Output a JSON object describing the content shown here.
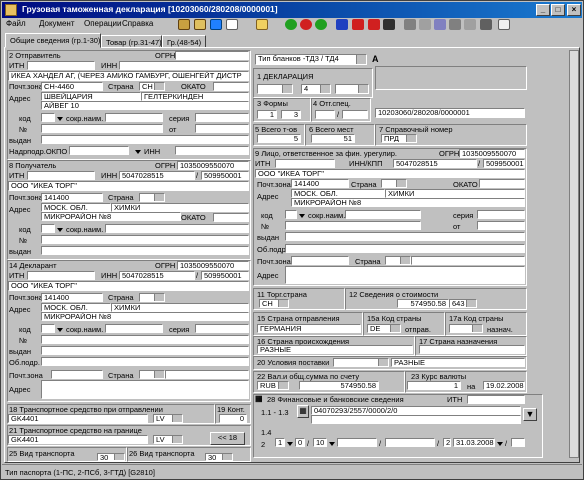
{
  "window": {
    "title": "Грузовая таможенная декларация [10203060/280208/0000001]",
    "min_label": "_",
    "max_label": "□",
    "close_label": "×"
  },
  "menu": [
    "Файл",
    "Документ",
    "Операции",
    "Справка"
  ],
  "tabs": [
    "Общие сведения (гр.1-30)",
    "Товар (гр.31-47)",
    "Гр.(48-54)"
  ],
  "section2": {
    "title": "2 Отправитель",
    "ogrn_label": "ОГРН",
    "inn_label": "ИТН",
    "inn2_label": "ИНН",
    "name": "ИКЕА ХАНДЕЛ АГ, (ЧЕРЕЗ АМИКО ГАМБУРГ, ОШЕНГЕЙТ ДИСТР",
    "postcode_label": "Почт.зона",
    "postcode": "CH-4460",
    "country_label": "Страна",
    "country": "CH",
    "okato_label": "ОКАТО",
    "address_label": "Адрес",
    "address1": "ШВЕЙЦАРИЯ",
    "address2": "ГЕЛТЕРКИНДЕН",
    "address3": "АЙВЕГ 10",
    "code_label": "код",
    "short_label": "сокр.наим.",
    "series_label": "серия",
    "no_label": "№",
    "from_label": "от",
    "issued_label": "выдан",
    "subdiv_label": "Надрподр.ОКПО",
    "inn3_label": "ИНН"
  },
  "section8": {
    "title": "8 Получатель",
    "ogrn_label": "ОГРН",
    "ogrn": "1035009550070",
    "inn_label": "ИТН",
    "inn2_label": "ИНН",
    "inn2": "5047028515",
    "kpp": "509950001",
    "name": "ООО \"ИКЕА ТОРГ\"",
    "postcode_label": "Почт.зона",
    "postcode": "141400",
    "country_label": "Страна",
    "address_label": "Адрес",
    "address1": "МОСК. ОБЛ.",
    "address2": "ХИМКИ",
    "address3": "МИКРОРАЙОН №8",
    "okato_label": "ОКАТО",
    "code_label": "код",
    "short_label": "сокр.наим.",
    "no_label": "№",
    "issued_label": "выдан"
  },
  "section14": {
    "title": "14 Декларант",
    "ogrn_label": "ОГРН",
    "ogrn": "1035009550070",
    "inn_label": "ИТН",
    "inn2_label": "ИНН",
    "inn2": "5047028515",
    "kpp": "509950001",
    "name": "ООО \"ИКЕА ТОРГ\"",
    "postcode_label": "Почт.зона",
    "postcode": "141400",
    "country_label": "Страна",
    "address_label": "Адрес",
    "address1": "МОСК. ОБЛ.",
    "address2": "ХИМКИ",
    "address3": "МИКРОРАЙОН №8",
    "code_label": "код",
    "short_label": "сокр.наим.",
    "series_label": "серия",
    "no_label": "№",
    "issued_label": "выдан",
    "subdiv_label": "Об.подр.",
    "postcode2_label": "Почт.зона",
    "country2_label": "Страна",
    "address2_label": "Адрес"
  },
  "section18": {
    "title": "18 Транспортное средство при отправлении",
    "value": "GK4401",
    "country": "LV",
    "cont_title": "19 Конт.",
    "cont": "0"
  },
  "section21": {
    "title": "21 Транспортное средство на границе",
    "value": "GK4401",
    "country": "LV",
    "button": "<< 18"
  },
  "section25": {
    "title": "25 Вид транспорта",
    "value": "30"
  },
  "section26": {
    "title": "26 Вид транспорта",
    "value": "30"
  },
  "right": {
    "blank_type": "Тип бланков -ТД3 / ТД4",
    "letter_a": "A",
    "decl_title": "1 ДЕКЛАРАЦИЯ",
    "decl2": "4",
    "forms_title": "3 Формы",
    "forms1": "1",
    "forms2": "3",
    "spec_title": "4 Отг.спец.",
    "decl_number": "10203060/280208/0000001",
    "total_title": "5 Всего т-ов",
    "total": "5",
    "places_title": "6 Всего мест",
    "places": "51",
    "ref_title": "7 Справочный номер",
    "ref": "ПРД",
    "responsible_title": "9 Лицо, ответственное за фин. урегулир.",
    "resp_ogrn_label": "ОГРН",
    "resp_ogrn": "1035009550070",
    "resp_inn_label": "ИТН",
    "resp_kpp_label": "ИНН/КПП",
    "resp_inn": "5047028515",
    "resp_kpp": "509950001",
    "resp_name": "ООО \"ИКЕА ТОРГ\"",
    "resp_postcode_label": "Почт.зона",
    "resp_postcode": "141400",
    "resp_country_label": "Страна",
    "resp_okato_label": "ОКАТО",
    "resp_address_label": "Адрес",
    "resp_address1": "МОСК. ОБЛ.",
    "resp_address2": "ХИМКИ",
    "resp_address3": "МИКРОРАЙОН №8",
    "resp_code_label": "код",
    "resp_short_label": "сокр.наим.",
    "resp_series_label": "серия",
    "resp_no_label": "№",
    "resp_from_label": "от",
    "resp_issued_label": "выдан",
    "resp_subdiv_label": "Об.подр.",
    "resp_postcode2_label": "Почт.зона",
    "resp_country2_label": "Страна",
    "resp_address2_label": "Адрес",
    "trade_country_title": "11 Торг.страна",
    "trade_country": "CH",
    "cost_title": "12 Сведения о стоимости",
    "cost": "574950.58",
    "cost_code": "643",
    "dispatch_title": "15 Страна отправления",
    "dispatch": "ГЕРМАНИЯ",
    "dispatch_code_title": "15a Код страны",
    "dispatch_code": "DE",
    "dispatch_code_sub": "отправ.",
    "dest_code_title": "17a Код страны",
    "dest_code_sub": "назнач.",
    "origin_title": "16 Страна происхождения",
    "origin": "РАЗНЫЕ",
    "dest_title": "17 Страна назначения",
    "delivery_title": "20 Условия поставки",
    "delivery": "РАЗНЫЕ",
    "currency_title": "22 Вал.и общ.сумма по счету",
    "currency": "RUB",
    "amount": "574950.58",
    "rate_title": "23 Курс валюты",
    "rate": "1",
    "rate_na": "на",
    "rate_date": "19.02.2008",
    "bank_title": "28 Финансовые и банковские сведения",
    "bank_inn_label": "ИТН",
    "bank_row1_label": "1.1 - 1.3",
    "bank_doc": "04070293/2557/0000/2/0",
    "bank_row2_label": "1.4",
    "bank_row3_label": "2",
    "bank_v1": "1",
    "bank_v2": "0",
    "bank_v3": "10",
    "bank_v4": "2",
    "bank_date": "31.03.2008"
  },
  "status": "Тип паспорта (1-ПС, 2-ПСб, 3-ГТД) [G2810]"
}
